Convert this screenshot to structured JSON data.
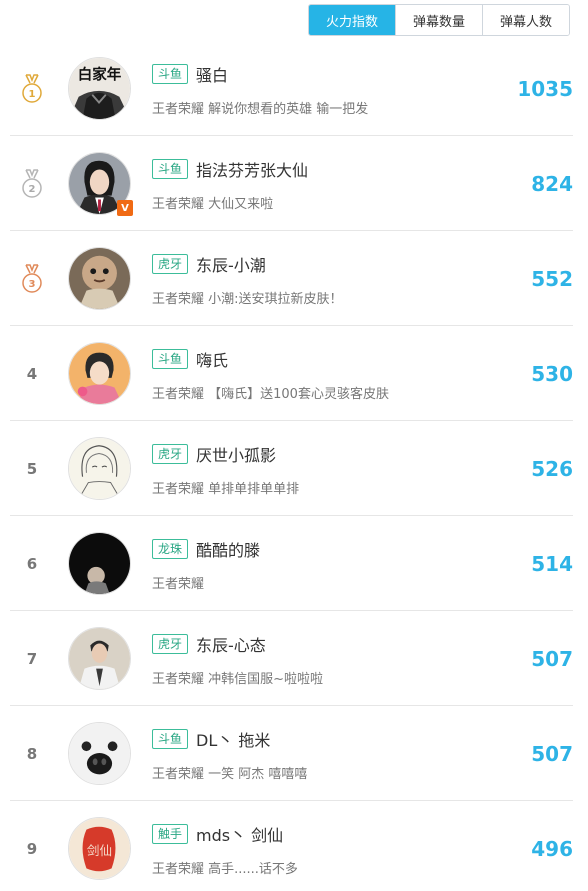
{
  "tabs": [
    {
      "label": "火力指数",
      "active": true
    },
    {
      "label": "弹幕数量",
      "active": false
    },
    {
      "label": "弹幕人数",
      "active": false
    }
  ],
  "colors": {
    "accent": "#26b4e6",
    "score": "#2eb3e6",
    "tag_border": "#3cbd9a",
    "gold": "#e0a93a",
    "silver": "#b5b5b5",
    "bronze": "#e08a5a",
    "verified": "#f06a14"
  },
  "rows": [
    {
      "rank": "1",
      "medal": "gold",
      "platform": "斗鱼",
      "name": "骚白",
      "sub": "王者荣耀 解说你想看的英雄 输一把发",
      "score": "1035",
      "avatar_caption": "白家年"
    },
    {
      "rank": "2",
      "medal": "silver",
      "platform": "斗鱼",
      "name": "指法芬芳张大仙",
      "sub": "王者荣耀 大仙又来啦",
      "score": "824",
      "verified": "V"
    },
    {
      "rank": "3",
      "medal": "bronze",
      "platform": "虎牙",
      "name": "东辰-小潮",
      "sub": "王者荣耀 小潮:送安琪拉新皮肤！",
      "score": "552"
    },
    {
      "rank": "4",
      "platform": "斗鱼",
      "name": "嗨氏",
      "sub": "王者荣耀 【嗨氏】送100套心灵骇客皮肤",
      "score": "530"
    },
    {
      "rank": "5",
      "platform": "虎牙",
      "name": "厌世小孤影",
      "sub": "王者荣耀 单排单排单单排",
      "score": "526"
    },
    {
      "rank": "6",
      "platform": "龙珠",
      "name": "酷酷的滕",
      "sub": "王者荣耀",
      "score": "514"
    },
    {
      "rank": "7",
      "platform": "虎牙",
      "name": "东辰-心态",
      "sub": "王者荣耀 冲韩信国服~啦啦啦",
      "score": "507"
    },
    {
      "rank": "8",
      "platform": "斗鱼",
      "name": "DL丶 拖米",
      "sub": "王者荣耀 一笑 阿杰 嘻嘻嘻",
      "score": "507"
    },
    {
      "rank": "9",
      "platform": "触手",
      "name": "mds丶 剑仙",
      "sub": "王者荣耀 高手......话不多",
      "score": "496",
      "avatar_caption": "剑仙"
    }
  ]
}
